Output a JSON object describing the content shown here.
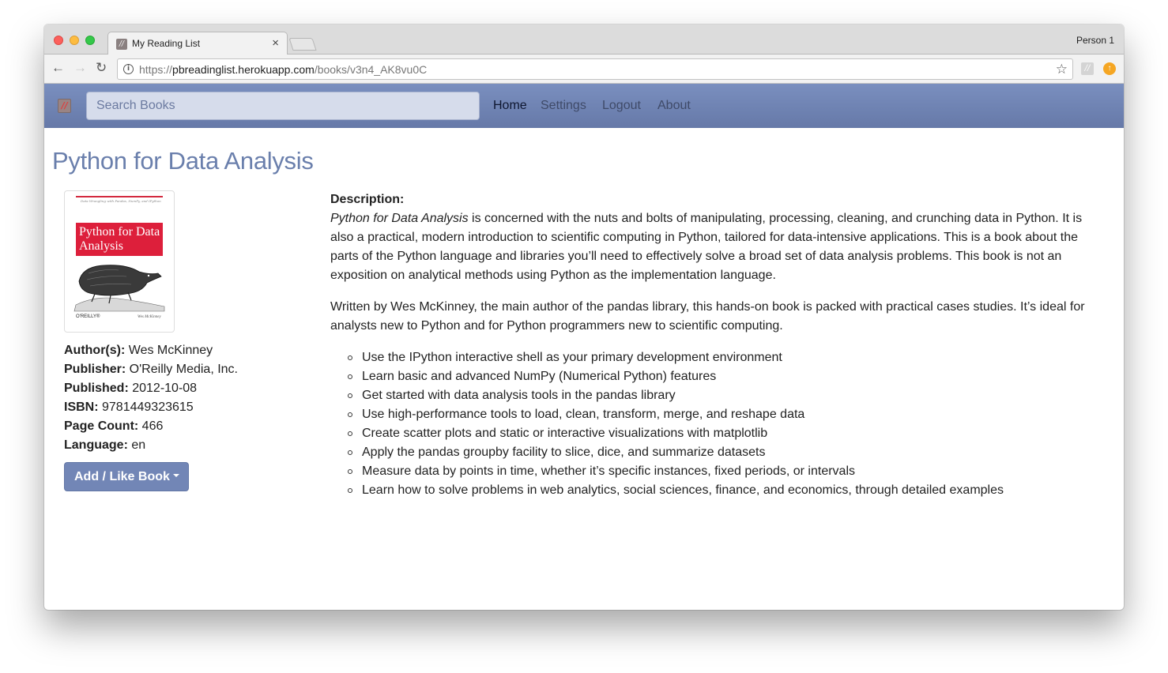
{
  "browser": {
    "tab_title": "My Reading List",
    "tab_close": "×",
    "profile_name": "Person 1",
    "url_scheme": "https://",
    "url_host": "pbreadinglist.herokuapp.com",
    "url_path": "/books/v3n4_AK8vu0C",
    "nav_back": "←",
    "nav_forward": "→",
    "nav_reload": "↻",
    "bookmark_star": "☆",
    "info": "i"
  },
  "navbar": {
    "search_placeholder": "Search Books",
    "links": [
      "Home",
      "Settings",
      "Logout",
      "About"
    ],
    "active_link": "Home"
  },
  "book": {
    "title": "Python for Data Analysis",
    "cover": {
      "subtitle": "Data Wrangling with Pandas, NumPy, and IPython",
      "title": "Python for Data Analysis",
      "publisher": "O'REILLY®",
      "author": "Wes McKinney"
    },
    "meta": [
      {
        "label": "Author(s):",
        "value": " Wes McKinney"
      },
      {
        "label": "Publisher:",
        "value": " O'Reilly Media, Inc."
      },
      {
        "label": "Published:",
        "value": " 2012-10-08"
      },
      {
        "label": "ISBN:",
        "value": " 9781449323615"
      },
      {
        "label": "Page Count:",
        "value": " 466"
      },
      {
        "label": "Language:",
        "value": " en"
      }
    ],
    "add_button": "Add / Like Book",
    "description_label": "Description:",
    "description_intro_italic": "Python for Data Analysis",
    "description_intro_rest": " is concerned with the nuts and bolts of manipulating, processing, cleaning, and crunching data in Python. It is also a practical, modern introduction to scientific computing in Python, tailored for data-intensive applications. This is a book about the parts of the Python language and libraries you’ll need to effectively solve a broad set of data analysis problems. This book is not an exposition on analytical methods using Python as the implementation language.",
    "description_second": "Written by Wes McKinney, the main author of the pandas library, this hands-on book is packed with practical cases studies. It’s ideal for analysts new to Python and for Python programmers new to scientific computing.",
    "bullets": [
      "Use the IPython interactive shell as your primary development environment",
      "Learn basic and advanced NumPy (Numerical Python) features",
      "Get started with data analysis tools in the pandas library",
      "Use high-performance tools to load, clean, transform, merge, and reshape data",
      "Create scatter plots and static or interactive visualizations with matplotlib",
      "Apply the pandas groupby facility to slice, dice, and summarize datasets",
      "Measure data by points in time, whether it’s specific instances, fixed periods, or intervals",
      "Learn how to solve problems in web analytics, social sciences, finance, and economics, through detailed examples"
    ]
  },
  "colors": {
    "navbar": "#7084b4",
    "title": "#6a7fac",
    "button": "#7286b6",
    "cover_red": "#dd1f3b"
  }
}
